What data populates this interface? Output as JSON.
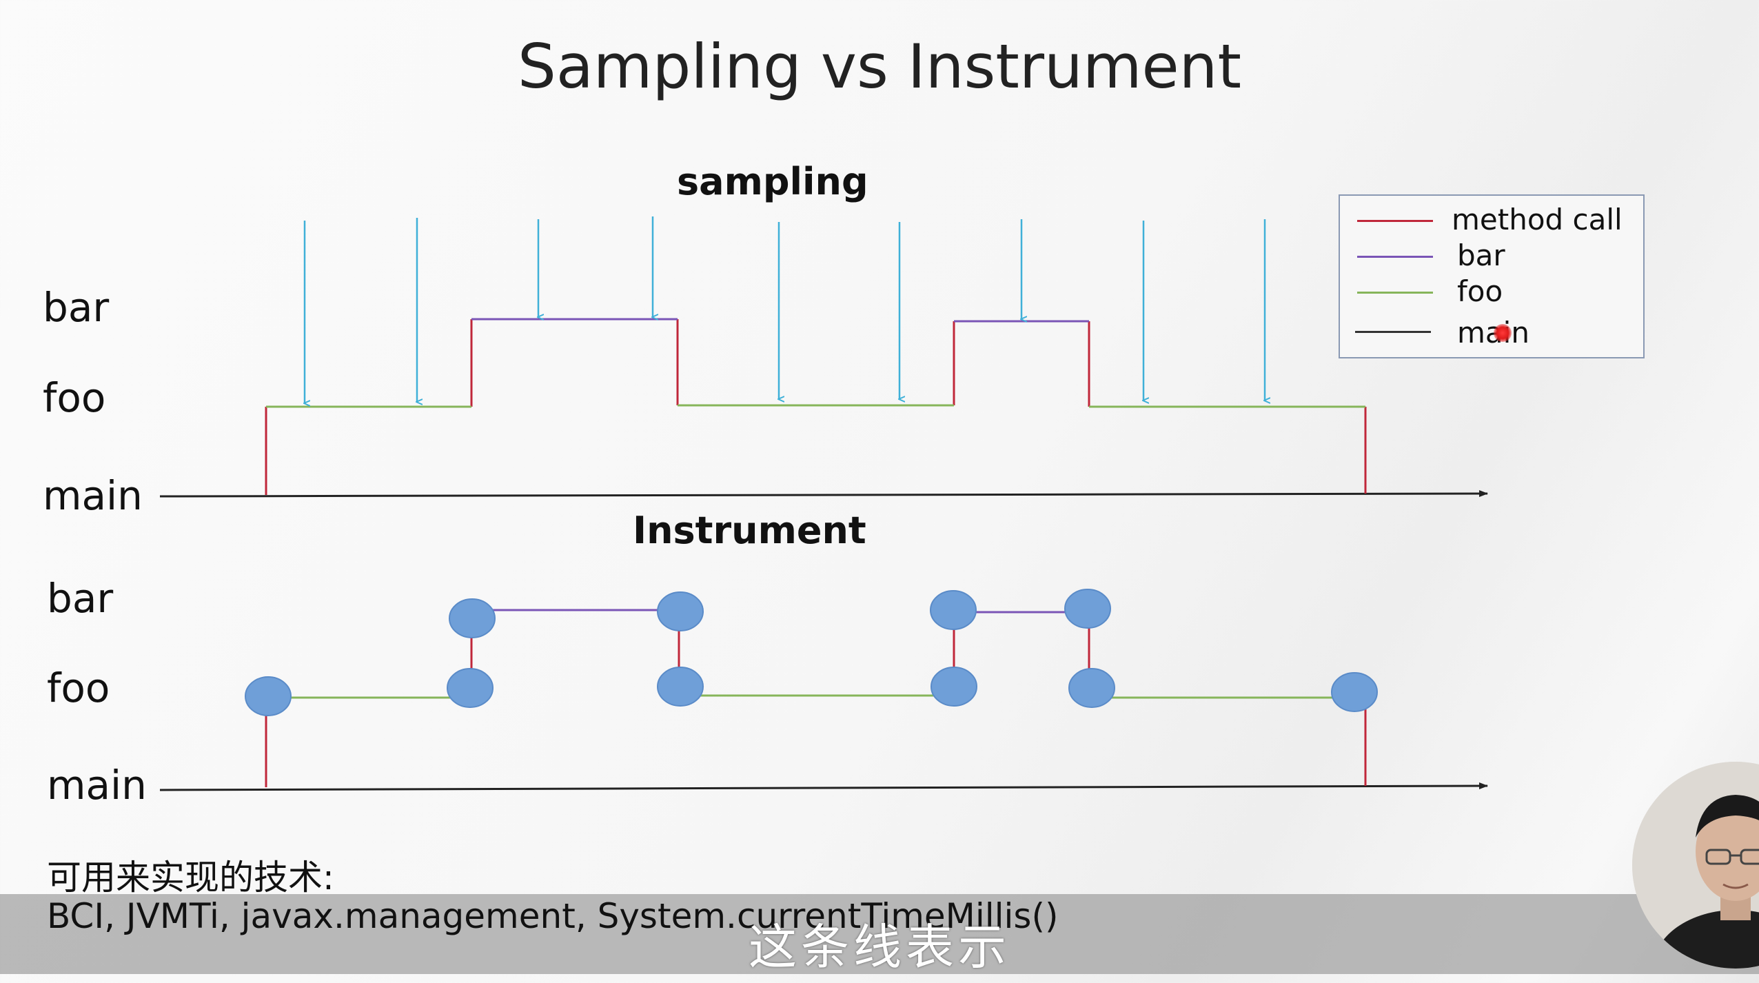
{
  "title": "Sampling vs Instrument",
  "sampling": {
    "heading": "sampling",
    "row_labels": {
      "bar": "bar",
      "foo": "foo",
      "main": "main"
    }
  },
  "instrument": {
    "heading": "Instrument",
    "row_labels": {
      "bar": "bar",
      "foo": "foo",
      "main": "main"
    }
  },
  "legend": {
    "items": [
      {
        "label": "method call",
        "color": "#c0273a"
      },
      {
        "label": "bar",
        "color": "#7a55b6"
      },
      {
        "label": "foo",
        "color": "#86b55a"
      },
      {
        "label": "main",
        "color": "#333333"
      }
    ]
  },
  "colors": {
    "sample_arrow": "#3fb0d8",
    "node_fill": "#6f9fd8",
    "axis": "#222222"
  },
  "footer": {
    "line1": "可用来实现的技术:",
    "line2": "BCI, JVMTi,  javax.management, System.currentTimeMillis()"
  },
  "subtitle": "这条线表示"
}
